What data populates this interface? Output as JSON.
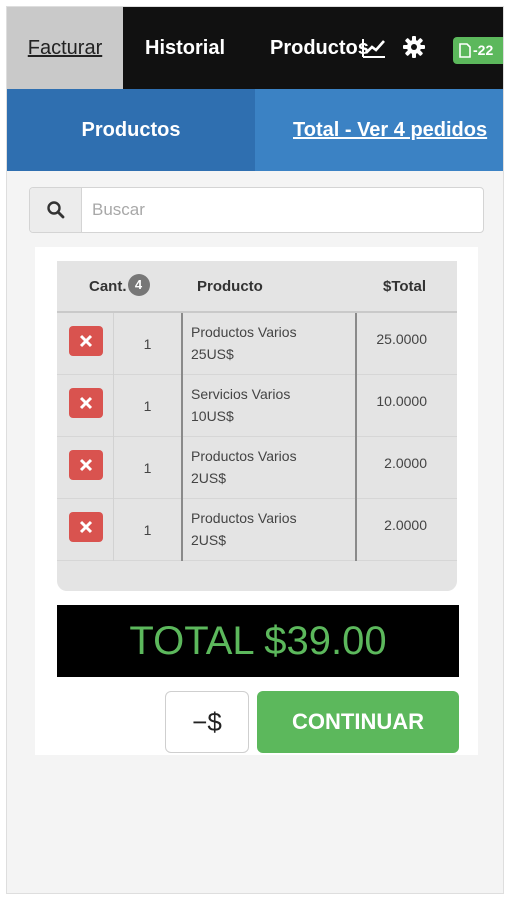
{
  "nav": {
    "tabs": [
      "Facturar",
      "Historial",
      "Productos"
    ],
    "chart_icon": "chart-line-icon",
    "settings_icon": "gear-icon",
    "badge": {
      "icon": "document-icon",
      "text": "-22"
    }
  },
  "subnav": {
    "left": "Productos",
    "right": "Total - Ver 4 pedidos"
  },
  "search": {
    "icon": "search-icon",
    "placeholder": "Buscar"
  },
  "table": {
    "headers": {
      "qty": "Cant.",
      "qty_count": "4",
      "product": "Producto",
      "total": "$Total"
    },
    "rows": [
      {
        "qty": "1",
        "product_line1": "Productos Varios",
        "product_line2": "25US$",
        "total": "25.0000"
      },
      {
        "qty": "1",
        "product_line1": "Servicios Varios",
        "product_line2": "10US$",
        "total": "10.0000"
      },
      {
        "qty": "1",
        "product_line1": "Productos Varios",
        "product_line2": "2US$",
        "total": "2.0000"
      },
      {
        "qty": "1",
        "product_line1": "Productos Varios",
        "product_line2": "2US$",
        "total": "2.0000"
      }
    ]
  },
  "total": {
    "label": "TOTAL $39.00"
  },
  "actions": {
    "money_label": "−$",
    "continue_label": "CONTINUAR"
  },
  "colors": {
    "nav_bg": "#111111",
    "subnav_bg": "#3b82c4",
    "danger": "#d9534f",
    "success": "#5cb85c"
  }
}
